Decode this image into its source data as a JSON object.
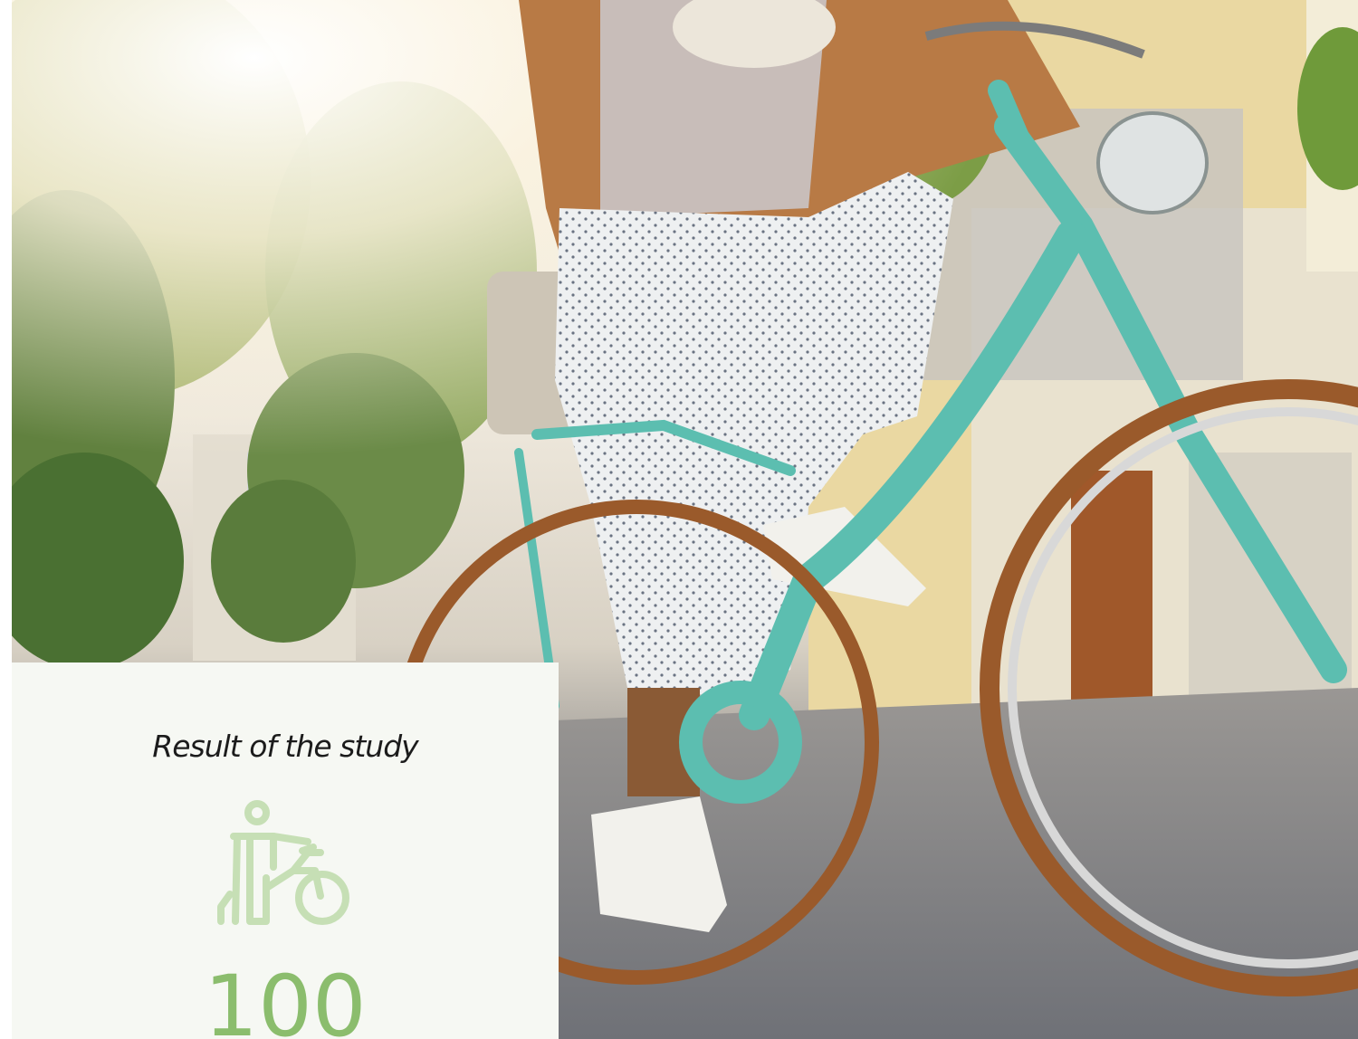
{
  "card": {
    "caption": "Result of the study",
    "icon": "person-with-bicycle-icon",
    "value": "100",
    "accent_color": "#8bbd6d",
    "icon_color": "#c6dfb5",
    "background_color": "#f6f8f3"
  }
}
